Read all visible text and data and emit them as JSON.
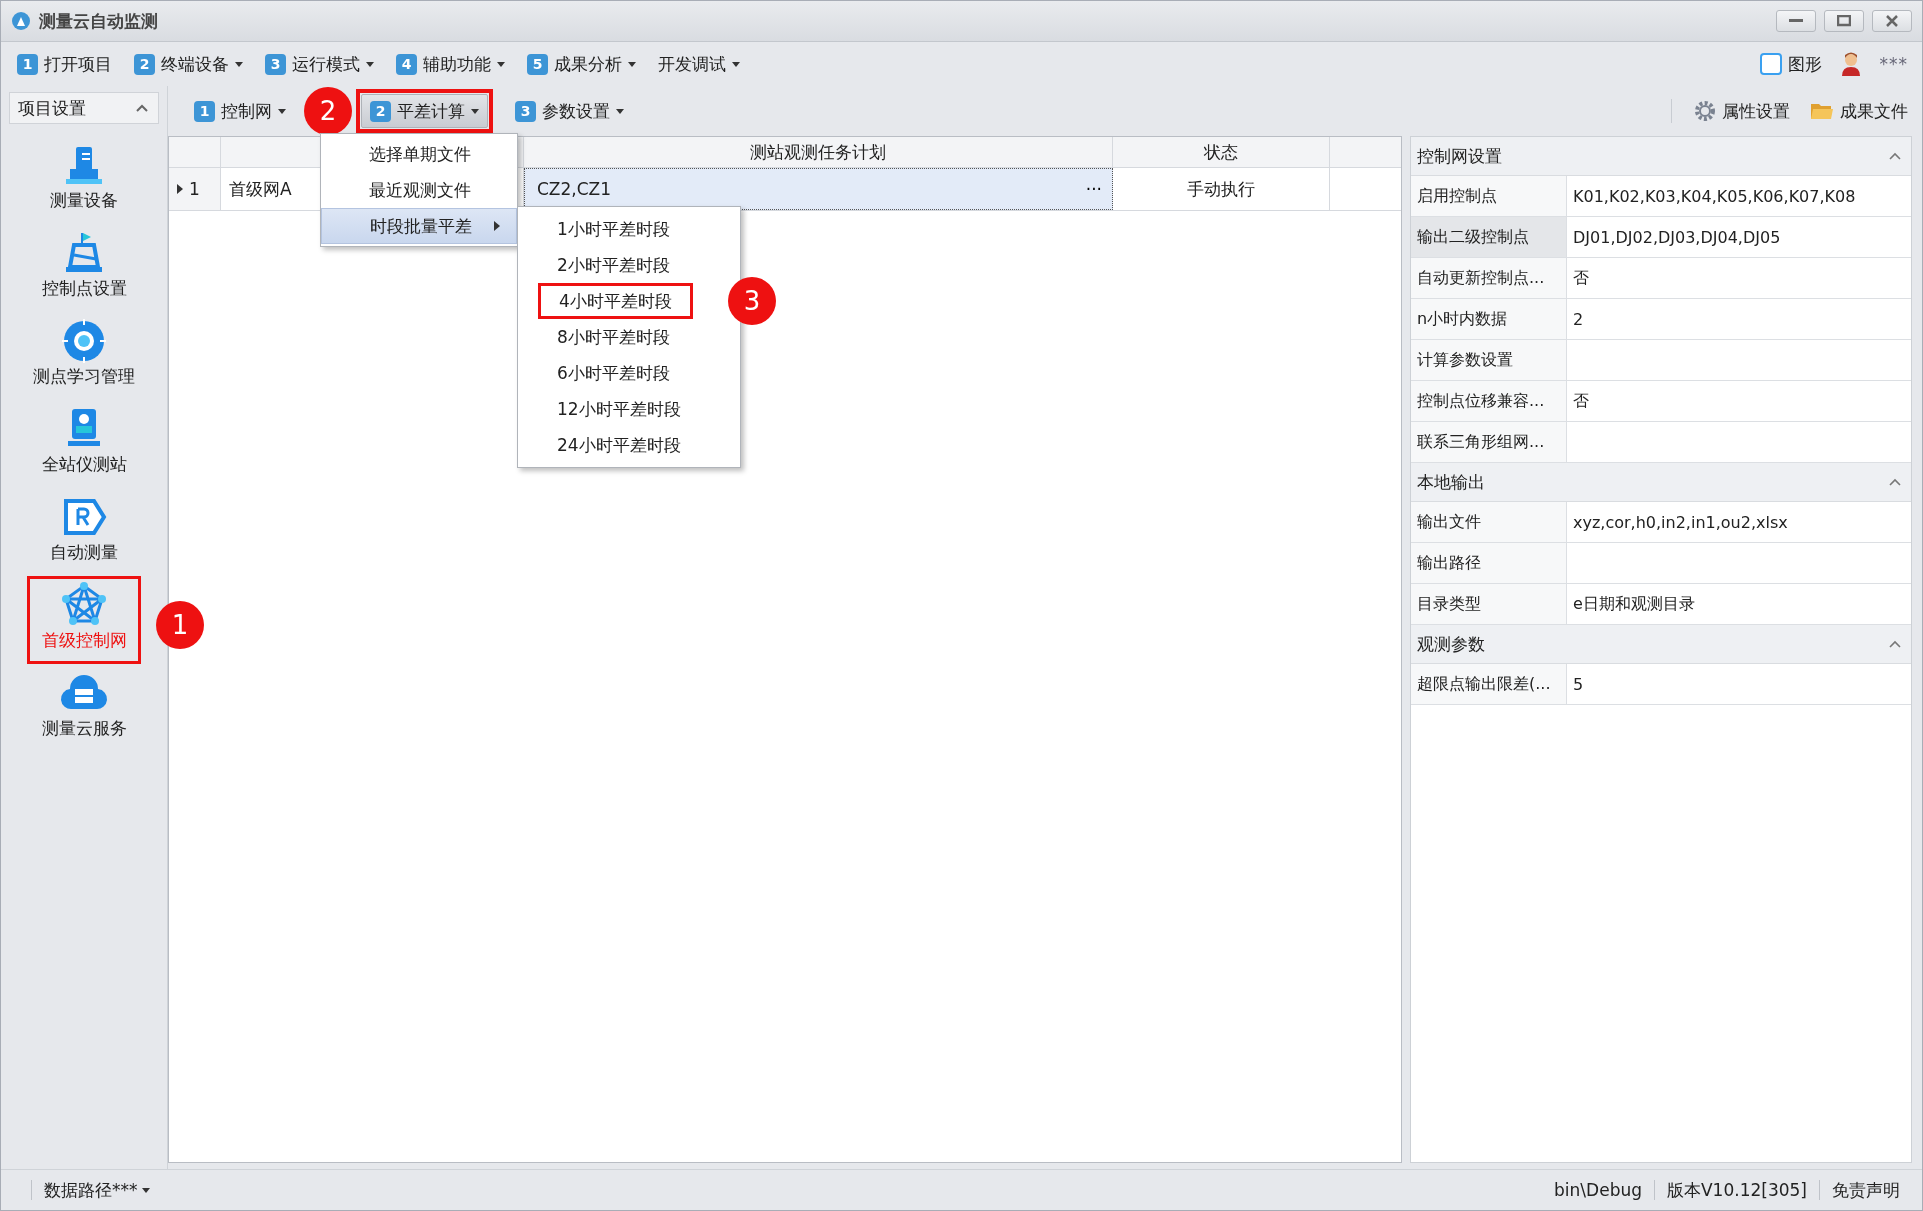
{
  "window": {
    "title": "测量云自动监测"
  },
  "menu_bar": {
    "items": [
      {
        "badge": "1",
        "label": "打开项目",
        "has_dropdown": false
      },
      {
        "badge": "2",
        "label": "终端设备",
        "has_dropdown": true
      },
      {
        "badge": "3",
        "label": "运行模式",
        "has_dropdown": true
      },
      {
        "badge": "4",
        "label": "辅助功能",
        "has_dropdown": true
      },
      {
        "badge": "5",
        "label": "成果分析",
        "has_dropdown": true
      },
      {
        "label": "开发调试",
        "has_dropdown": true
      }
    ],
    "graphics_checkbox": {
      "label": "图形",
      "checked": false
    },
    "user": {
      "name": "***"
    }
  },
  "sidebar": {
    "group": {
      "title": "项目设置",
      "expanded": true
    },
    "items": [
      {
        "label": "测量设备",
        "selected": false
      },
      {
        "label": "控制点设置",
        "selected": false
      },
      {
        "label": "测点学习管理",
        "selected": false
      },
      {
        "label": "全站仪测站",
        "selected": false
      },
      {
        "label": "自动测量",
        "selected": false
      },
      {
        "label": "首级控制网",
        "selected": true,
        "highlighted": true,
        "callout": "1"
      },
      {
        "label": "测量云服务",
        "selected": false
      }
    ]
  },
  "toolbar": {
    "buttons": [
      {
        "badge": "1",
        "label": "控制网",
        "pressed": false
      },
      {
        "badge": "2",
        "label": "平差计算",
        "pressed": true,
        "highlighted": true,
        "callout": "2"
      },
      {
        "badge": "3",
        "label": "参数设置",
        "pressed": false
      }
    ],
    "right_buttons": [
      {
        "label": "属性设置"
      },
      {
        "label": "成果文件"
      }
    ]
  },
  "dropdown_menu": {
    "items": [
      {
        "label": "选择单期文件",
        "selected": false
      },
      {
        "label": "最近观测文件",
        "selected": false
      },
      {
        "label": "时段批量平差",
        "selected": true,
        "has_submenu": true
      }
    ]
  },
  "submenu": {
    "items": [
      {
        "label": "1小时平差时段",
        "highlighted": false
      },
      {
        "label": "2小时平差时段",
        "highlighted": false
      },
      {
        "label": "4小时平差时段",
        "highlighted": true,
        "callout": "3"
      },
      {
        "label": "8小时平差时段",
        "highlighted": false
      },
      {
        "label": "6小时平差时段",
        "highlighted": false
      },
      {
        "label": "12小时平差时段",
        "highlighted": false
      },
      {
        "label": "24小时平差时段",
        "highlighted": false
      }
    ]
  },
  "table": {
    "columns": [
      "测站观测任务计划",
      "状态"
    ],
    "rows": [
      {
        "row_number": "1",
        "current": true,
        "name": "首级网A",
        "task_plan": "CZ2,CZ1",
        "edit_button": "···",
        "status": "手动执行",
        "selected": true
      }
    ]
  },
  "property_grid": {
    "sections": [
      {
        "title": "控制网设置",
        "expanded": true,
        "rows": [
          {
            "label": "启用控制点",
            "value": "K01,K02,K03,K04,K05,K06,K07,K08",
            "selected": false
          },
          {
            "label": "输出二级控制点",
            "value": "DJ01,DJ02,DJ03,DJ04,DJ05",
            "selected": true
          },
          {
            "label": "自动更新控制点...",
            "value": "否",
            "selected": false
          },
          {
            "label": "n小时内数据",
            "value": "2",
            "selected": false
          },
          {
            "label": "计算参数设置",
            "selected": false
          },
          {
            "label": "控制点位移兼容...",
            "value": "否",
            "selected": false
          },
          {
            "label": "联系三角形组网...",
            "selected": false
          }
        ]
      },
      {
        "title": "本地输出",
        "expanded": true,
        "rows": [
          {
            "label": "输出文件",
            "value": "xyz,cor,h0,in2,in1,ou2,xlsx",
            "selected": false
          },
          {
            "label": "输出路径",
            "selected": false
          },
          {
            "label": "目录类型",
            "value": "e日期和观测目录",
            "selected": false
          }
        ]
      },
      {
        "title": "观测参数",
        "expanded": true,
        "rows": [
          {
            "label": "超限点输出限差(...",
            "value": "5",
            "selected": false
          }
        ]
      }
    ]
  },
  "status_bar": {
    "data_path": "数据路径***",
    "build": "bin\\Debug",
    "version": "版本V10.12[305]",
    "disclaimer": "免责声明"
  }
}
